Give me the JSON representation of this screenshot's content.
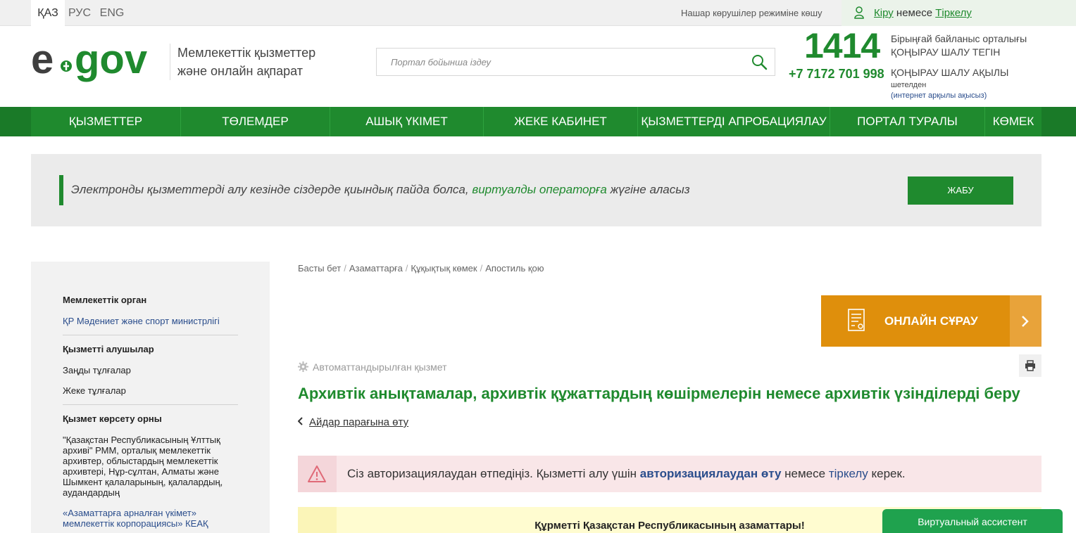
{
  "topbar": {
    "languages": [
      "ҚАЗ",
      "РУС",
      "ENG"
    ],
    "vision_mode": "Нашар көрушілер режиміне көшу",
    "login": "Кіру",
    "login_or": "немесе",
    "register": "Тіркелу"
  },
  "header": {
    "tagline_1": "Мемлекеттік қызметтер",
    "tagline_2": "және онлайн ақпарат",
    "search_placeholder": "Портал бойынша іздеу",
    "hotline_number": "1414",
    "hotline_phone": "+7 7172 701 998",
    "hotline_desc_1": "Бірыңғай байланыс орталығы",
    "hotline_desc_2": "ҚОҢЫРАУ ШАЛУ ТЕГІН",
    "hotline_desc_3": "ҚОҢЫРАУ ШАЛУ АҚЫЛЫ",
    "hotline_abroad": "шетелден",
    "hotline_abroad_note": "(интернет арқылы ақысыз)"
  },
  "nav": {
    "items": [
      "ҚЫЗМЕТТЕР",
      "ТӨЛЕМДЕР",
      "АШЫҚ ҮКІМЕТ",
      "ЖЕКЕ КАБИНЕТ",
      "ҚЫЗМЕТТЕРДІ АПРОБАЦИЯЛАУ",
      "ПОРТАЛ ТУРАЛЫ",
      "КӨМЕК"
    ]
  },
  "notice": {
    "text_before": "Электронды қызметтерді алу кезінде сіздерде қиындық пайда болса, ",
    "link": "виртуалды операторға",
    "text_after": " жүгіне аласыз",
    "close_label": "ЖАБУ"
  },
  "sidebar": {
    "agency_heading": "Мемлекеттік орган",
    "agency_value": "ҚР Мәдениет және спорт министрлігі",
    "recipients_heading": "Қызметті алушылар",
    "recipients": [
      "Заңды тұлғалар",
      "Жеке тұлғалар"
    ],
    "place_heading": "Қызмет көрсету орны",
    "place_text": "\"Қазақстан Республикасының Ұлттық архиві\" РММ, орталық мемлекеттік архивтер, облыстардың мемлекеттік архивтері, Нұр-сұлтан, Алматы және Шымкент қалаларының, қалалардың, аудандардың",
    "place_link": "«Азаматтарға арналған үкімет» мемлекеттік корпорациясы» КЕАҚ"
  },
  "main": {
    "breadcrumbs": [
      "Басты бет",
      "Азаматтарға",
      "Құқықтық көмек",
      "Апостиль қою"
    ],
    "online_request": "ОНЛАЙН СҰРАУ",
    "automated": "Автоматтандырылған қызмет",
    "title": "Архивтік анықтамалар, архивтік құжаттардың көшірмелерін немесе архивтік үзінділерді беру",
    "back_link": "Айдар парағына өту",
    "alert_before": "Сіз авторизациялаудан өтпедіңіз. Қызметті алу үшін ",
    "alert_link1": "авторизациялаудан өту",
    "alert_mid": " немесе ",
    "alert_link2": "тіркелу",
    "alert_after": " керек.",
    "citizens_heading": "Құрметті Қазақстан Республикасының азаматтары!",
    "assistant": "Виртуальный ассистент"
  },
  "colors": {
    "brand_green": "#1f8a2e",
    "orange": "#df8f0c",
    "link_blue": "#2a4d8c"
  }
}
